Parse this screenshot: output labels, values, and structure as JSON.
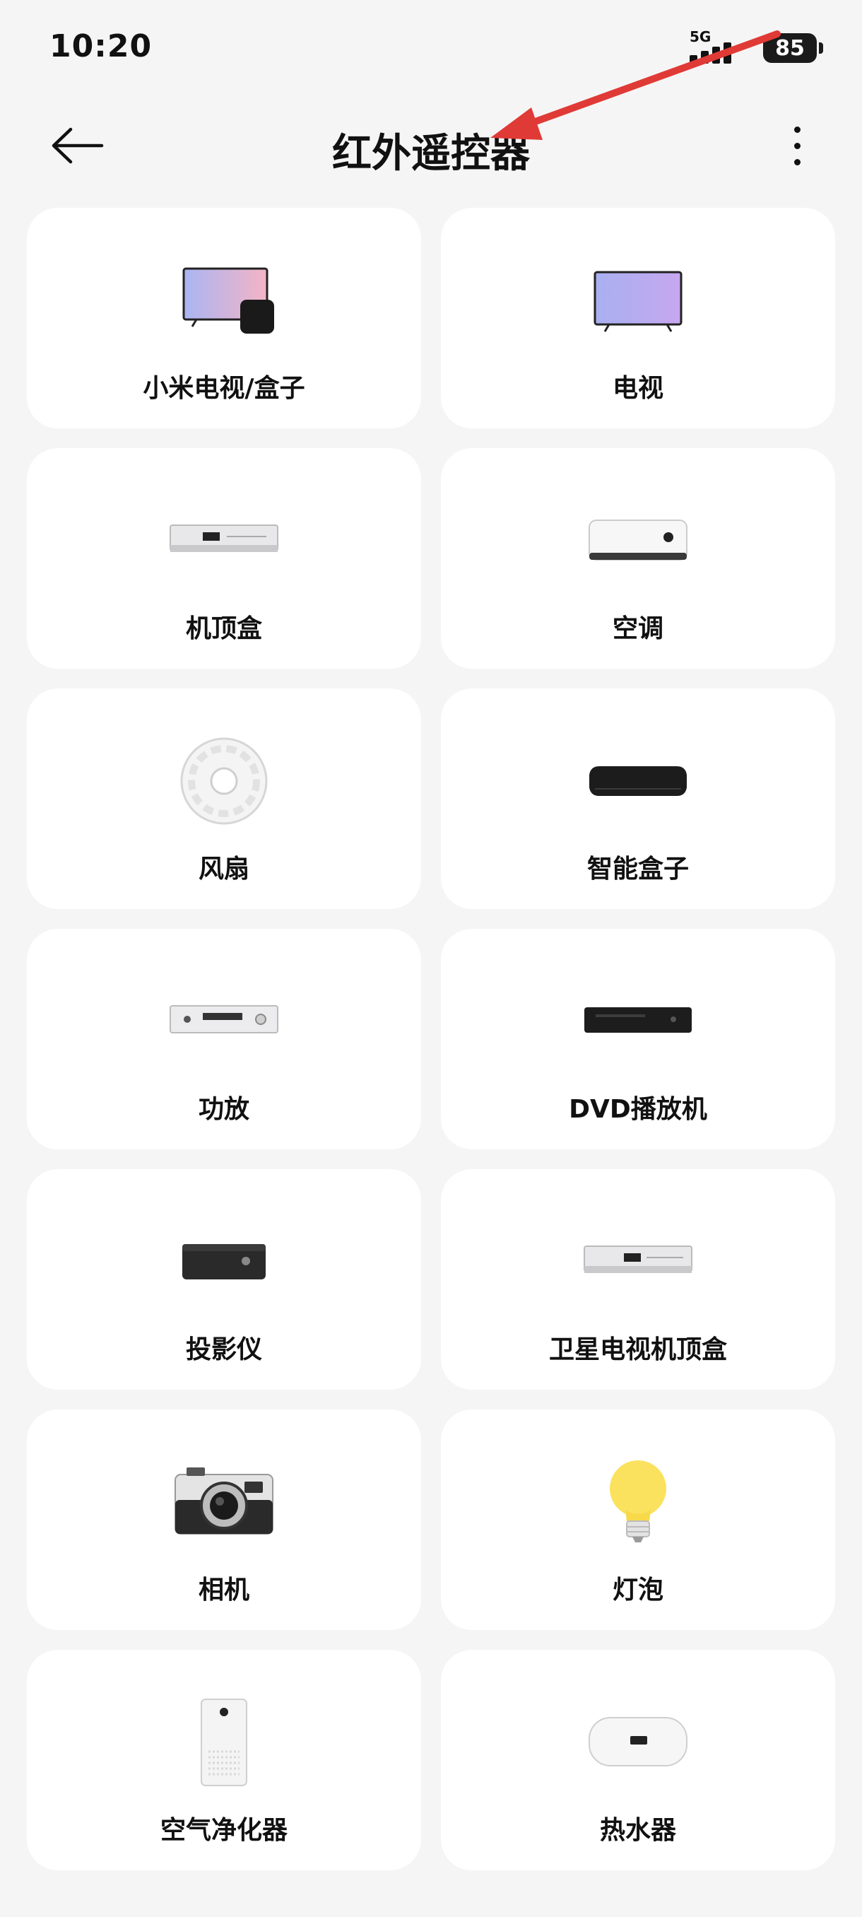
{
  "status_bar": {
    "time": "10:20",
    "network": "5G",
    "battery": "85"
  },
  "header": {
    "title": "红外遥控器"
  },
  "devices": [
    {
      "label": "小米电视/盒子",
      "icon": "tv-box-icon"
    },
    {
      "label": "电视",
      "icon": "tv-icon"
    },
    {
      "label": "机顶盒",
      "icon": "set-top-box-icon"
    },
    {
      "label": "空调",
      "icon": "air-conditioner-icon"
    },
    {
      "label": "风扇",
      "icon": "fan-icon"
    },
    {
      "label": "智能盒子",
      "icon": "smart-box-icon"
    },
    {
      "label": "功放",
      "icon": "amplifier-icon"
    },
    {
      "label": "DVD播放机",
      "icon": "dvd-player-icon"
    },
    {
      "label": "投影仪",
      "icon": "projector-icon"
    },
    {
      "label": "卫星电视机顶盒",
      "icon": "satellite-box-icon"
    },
    {
      "label": "相机",
      "icon": "camera-icon"
    },
    {
      "label": "灯泡",
      "icon": "light-bulb-icon"
    },
    {
      "label": "空气净化器",
      "icon": "air-purifier-icon"
    },
    {
      "label": "热水器",
      "icon": "water-heater-icon"
    }
  ],
  "colors": {
    "background": "#f5f5f5",
    "card": "#ffffff",
    "annotation_arrow": "#e03a36"
  }
}
